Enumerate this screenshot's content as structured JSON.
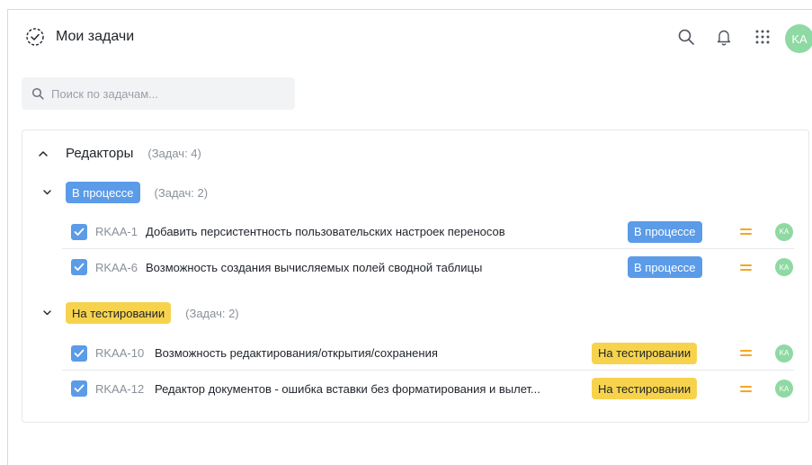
{
  "header": {
    "title": "Мои задачи",
    "title_icon": "check-circle-dashed-icon",
    "icons": [
      "search-icon",
      "bell-icon",
      "apps-grid-icon"
    ],
    "avatar": "KA",
    "avatar_color": "#8fd9a3"
  },
  "search": {
    "placeholder": "Поиск по задачам..."
  },
  "group": {
    "title": "Редакторы",
    "count": "(Задач: 4)",
    "subgroups": [
      {
        "status": "В процессе",
        "count": "(Задач: 2)",
        "color": "#5b9be8",
        "tasks": [
          {
            "key": "RKAA-1",
            "title": "Добавить персистентность пользовательских настроек переносов",
            "status": "В процессе",
            "assignee": "KA",
            "checked": true
          },
          {
            "key": "RKAA-6",
            "title": "Возможность создания вычисляемых полей сводной таблицы",
            "status": "В процессе",
            "assignee": "KA",
            "checked": true
          }
        ]
      },
      {
        "status": "На тестировании",
        "count": "(Задач: 2)",
        "color": "#f7d34d",
        "tasks": [
          {
            "key": "RKAA-10",
            "title": "Возможность редактирования/открытия/сохранения",
            "status": "На тестировании",
            "assignee": "KA",
            "checked": true
          },
          {
            "key": "RKAA-12",
            "title": "Редактор документов - ошибка вставки без форматирования и вылет...",
            "status": "На тестировании",
            "assignee": "KA",
            "checked": true
          }
        ]
      }
    ]
  },
  "priority_color": "#f5a623"
}
